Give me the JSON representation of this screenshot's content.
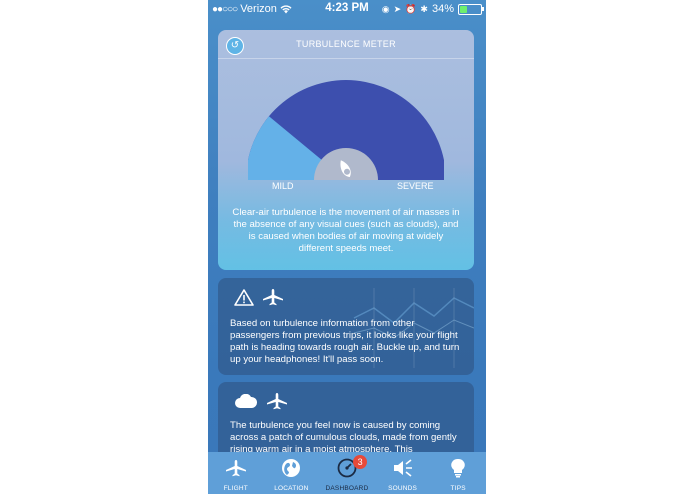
{
  "status_bar": {
    "carrier": "Verizon",
    "time": "4:23 PM",
    "battery": "34%",
    "battery_level": 0.34
  },
  "meter_card": {
    "title": "TURBULENCE METER",
    "mild_label": "MILD",
    "severe_label": "SEVERE",
    "level": 0.22,
    "description": "Clear-air turbulence is the movement of air masses in the absence of any visual cues (such as clouds), and is caused when bodies of air moving at widely different speeds meet."
  },
  "info_cards": [
    {
      "icons": [
        "warning-icon",
        "airplane-icon"
      ],
      "text": "Based on turbulence information from other passengers from previous trips, it looks like your flight path is heading towards rough air. Buckle up, and turn up your headphones! It'll pass soon."
    },
    {
      "icons": [
        "cloud-icon",
        "airplane-icon"
      ],
      "text": "The turbulence you feel now is caused by coming across a patch of cumulous clouds, made from gently rising warm air in a moist atmosphere. This"
    }
  ],
  "tabs": [
    {
      "label": "FLIGHT",
      "icon": "airplane-icon"
    },
    {
      "label": "LOCATION",
      "icon": "globe-icon"
    },
    {
      "label": "DASHBOARD",
      "icon": "gauge-icon",
      "badge": "3",
      "active": true
    },
    {
      "label": "SOUNDS",
      "icon": "speaker-icon"
    },
    {
      "label": "TIPS",
      "icon": "lightbulb-icon"
    }
  ],
  "colors": {
    "gauge_dark": "#3d4fae",
    "gauge_light": "#64b1e8",
    "badge": "#e74a3a"
  }
}
